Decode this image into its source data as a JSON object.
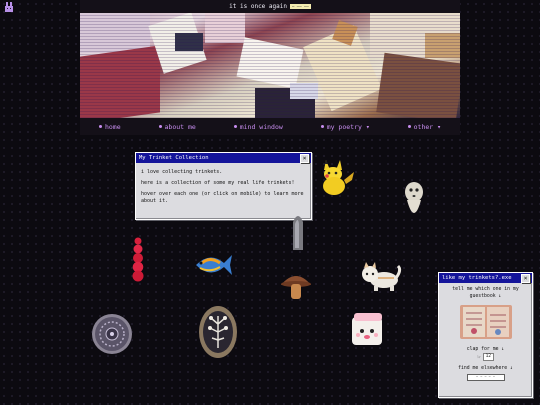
{
  "header": {
    "title": "it is once again",
    "badge": "— —— ——"
  },
  "nav": [
    {
      "label": "home"
    },
    {
      "label": "about me"
    },
    {
      "label": "mind window"
    },
    {
      "label": "my poetry ▾"
    },
    {
      "label": "other ▾"
    }
  ],
  "collection_window": {
    "title": "My Trinket Collection",
    "close": "×",
    "lines": [
      "i love collecting trinkets.",
      "here is a collection of some my real life trinkets!",
      "hover over each one (or click on mobile) to learn more about it."
    ]
  },
  "guestbook_window": {
    "title": "like my trinkets?.exe",
    "close": "×",
    "guestbook_prompt": "tell me which one in my guestbook ↓",
    "clap_label": "clap for me ↓",
    "clap_count": "12",
    "stamps_label": "find me elsewhere ↓",
    "stamp_button": "~ ~ ~ ~ ~"
  },
  "colors": {
    "nav": "#c88ef0",
    "titlebar": "#14149a",
    "window": "#dcdce0"
  }
}
